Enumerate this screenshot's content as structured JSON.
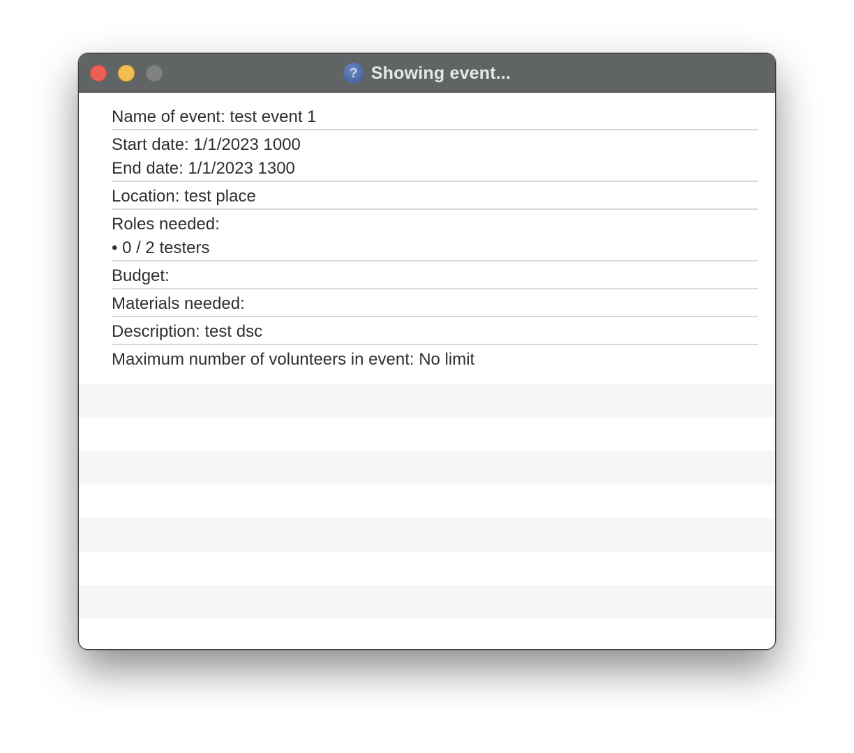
{
  "window": {
    "title": "Showing event...",
    "app_icon": "question-mark-icon",
    "app_icon_glyph": "?",
    "traffic_lights": [
      "close",
      "minimize",
      "zoom"
    ],
    "colors": {
      "titlebar": "#616465",
      "close": "#ec5f57",
      "minimize": "#f3bd4f",
      "zoom": "#7f8183"
    }
  },
  "event": {
    "name": "Name of event: test event 1",
    "start_date": "Start date: 1/1/2023 1000",
    "end_date": "End date: 1/1/2023 1300",
    "location": "Location: test place",
    "roles_header": "Roles needed:",
    "roles": [
      "• 0 / 2 testers"
    ],
    "budget": "Budget:",
    "materials": "Materials needed:",
    "description": "Description: test dsc",
    "max_volunteers": "Maximum number of volunteers in event: No limit"
  }
}
